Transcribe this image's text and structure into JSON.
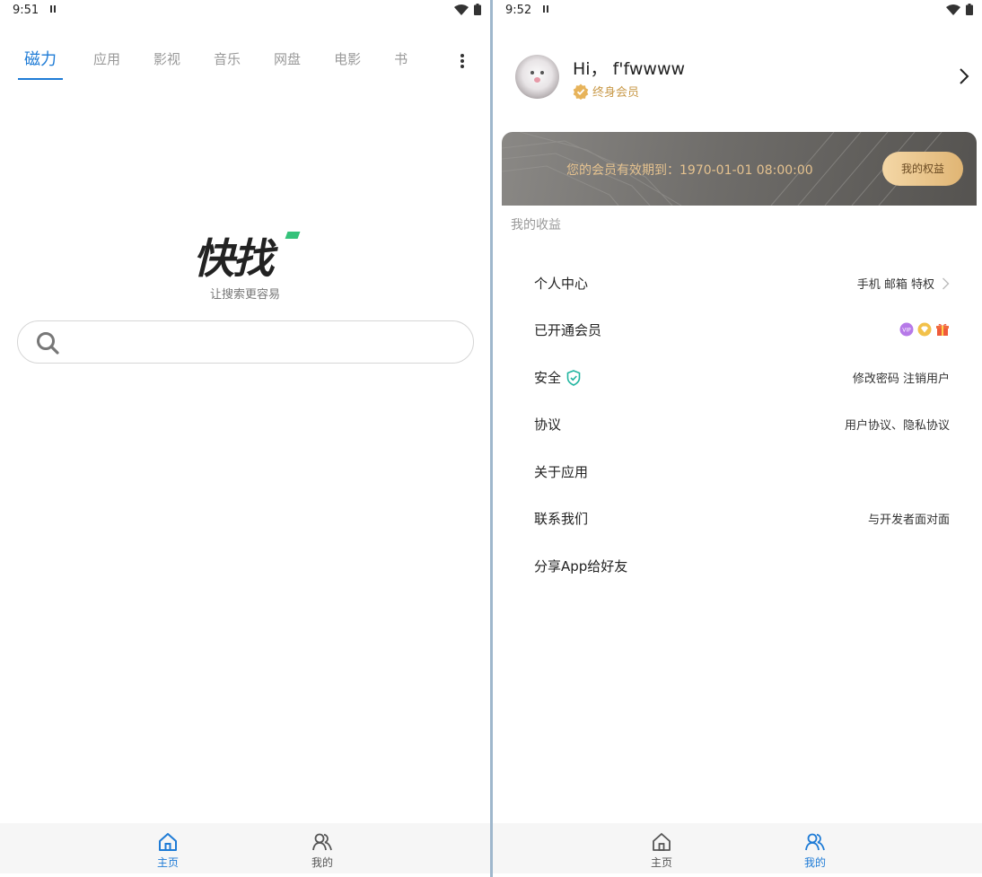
{
  "left": {
    "status": {
      "time": "9:51"
    },
    "tabs": [
      {
        "label": "磁力",
        "active": true
      },
      {
        "label": "应用",
        "active": false
      },
      {
        "label": "影视",
        "active": false
      },
      {
        "label": "音乐",
        "active": false
      },
      {
        "label": "网盘",
        "active": false
      },
      {
        "label": "电影",
        "active": false
      },
      {
        "label": "书",
        "active": false
      }
    ],
    "logo_text": "快找",
    "slogan": "让搜索更容易",
    "search": {
      "placeholder": ""
    },
    "nav": {
      "home": "主页",
      "mine": "我的",
      "active": "home"
    }
  },
  "right": {
    "status": {
      "time": "9:52"
    },
    "profile": {
      "greeting": "Hi，  f'fwwww",
      "membership": "终身会员"
    },
    "card": {
      "expire_text": "您的会员有效期到：1970-01-01 08:00:00",
      "rights_button": "我的权益"
    },
    "earnings_title": "我的收益",
    "menu": [
      {
        "label": "个人中心",
        "value": "手机 邮箱 特权",
        "chevron": true
      },
      {
        "label": "已开通会员",
        "value": "",
        "badges": [
          "vip-icon",
          "diamond-icon",
          "gift-icon"
        ]
      },
      {
        "label": "安全",
        "value": "修改密码  注销用户",
        "shield": true
      },
      {
        "label": "协议",
        "value": "用户协议、隐私协议"
      },
      {
        "label": "关于应用",
        "value": ""
      },
      {
        "label": "联系我们",
        "value": "与开发者面对面"
      },
      {
        "label": "分享App给好友",
        "value": ""
      }
    ],
    "nav": {
      "home": "主页",
      "mine": "我的",
      "active": "mine"
    }
  },
  "colors": {
    "accent": "#1e7bd6",
    "gold": "#c99a4a",
    "card_text": "#e5c28f",
    "logo_green": "#35c27a"
  }
}
